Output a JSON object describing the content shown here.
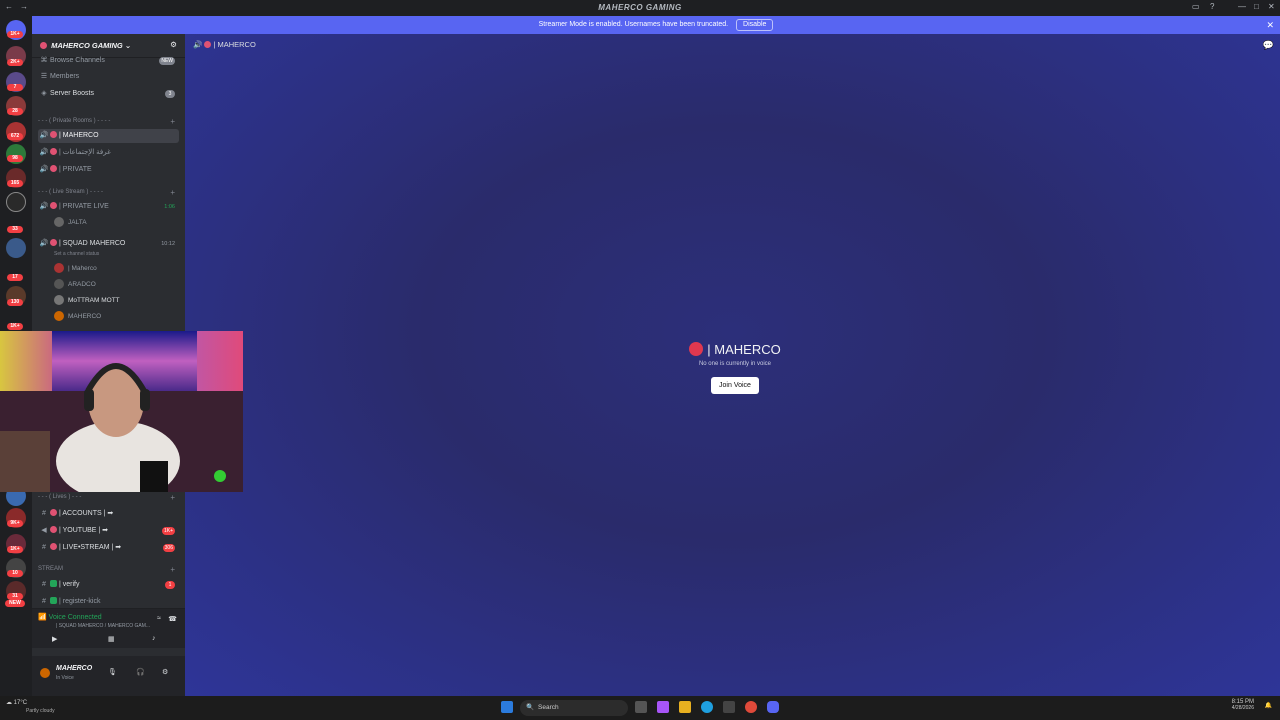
{
  "window": {
    "title": "MAHERCO GAMING"
  },
  "banner": {
    "text": "Streamer Mode is enabled. Usernames have been truncated.",
    "disable": "Disable"
  },
  "guild_badges": [
    "1K+",
    "2K+",
    "7",
    "28",
    "672",
    "98",
    "165",
    "33",
    "17",
    "130",
    "1K+",
    "9K+",
    "1K+",
    "10",
    "31",
    "1K+",
    "NEW"
  ],
  "server": {
    "name": "MAHERCO GAMING"
  },
  "nav": {
    "browse": "Browse Channels",
    "browse_badge": "NEW",
    "members": "Members",
    "boosts": "Server Boosts",
    "boosts_count": "3"
  },
  "categories": {
    "private": "- - - ( Private Rooms ) - - - -",
    "live": "- - - ( Live Stream ) - - - -",
    "lives": "- - - ( Lives ) - - -",
    "stream": "STREAM"
  },
  "channels": {
    "maherco": "| MAHERCO",
    "meetings": "| غرفة الإجتماعات",
    "private": "| PRIVATE",
    "private_live": "| PRIVATE LIVE",
    "private_live_time": "1:06",
    "squad": "| SQUAD MAHERCO",
    "squad_time": "10:12",
    "squad_status": "Set a channel status",
    "accounts": "| ACCOUNTS | ➡",
    "youtube": "| YOUTUBE | ➡",
    "youtube_badge": "1K+",
    "livestream": "| LIVE•STREAM | ➡",
    "livestream_badge": "306",
    "verify": "| verify",
    "verify_badge": "1",
    "register": "| register-kick"
  },
  "voice_users": {
    "jalta": "JALTA",
    "u1": "| Maherco",
    "u2": "ARADCO",
    "u3": "MoTTRAM",
    "u3_tag": "MOTT",
    "u4": "MAHERCO"
  },
  "voice": {
    "status": "Voice Connected",
    "channel": "| SQUAD MAHERCO / MAHERCO GAM..."
  },
  "user": {
    "name": "MAHERCO",
    "status": "In Voice"
  },
  "main": {
    "channel_title": "| MAHERCO",
    "center_title": "| MAHERCO",
    "center_sub": "No one is currently in voice",
    "join": "Join Voice"
  },
  "taskbar": {
    "weather_temp": "17°C",
    "weather_desc": "Partly cloudy",
    "search": "Search",
    "time": "8:15 PM",
    "date": "4/28/2026"
  },
  "colors": {
    "accent": "#5865f2",
    "sidebar": "#2b2d31",
    "main_bg": "#2c2f7a"
  }
}
